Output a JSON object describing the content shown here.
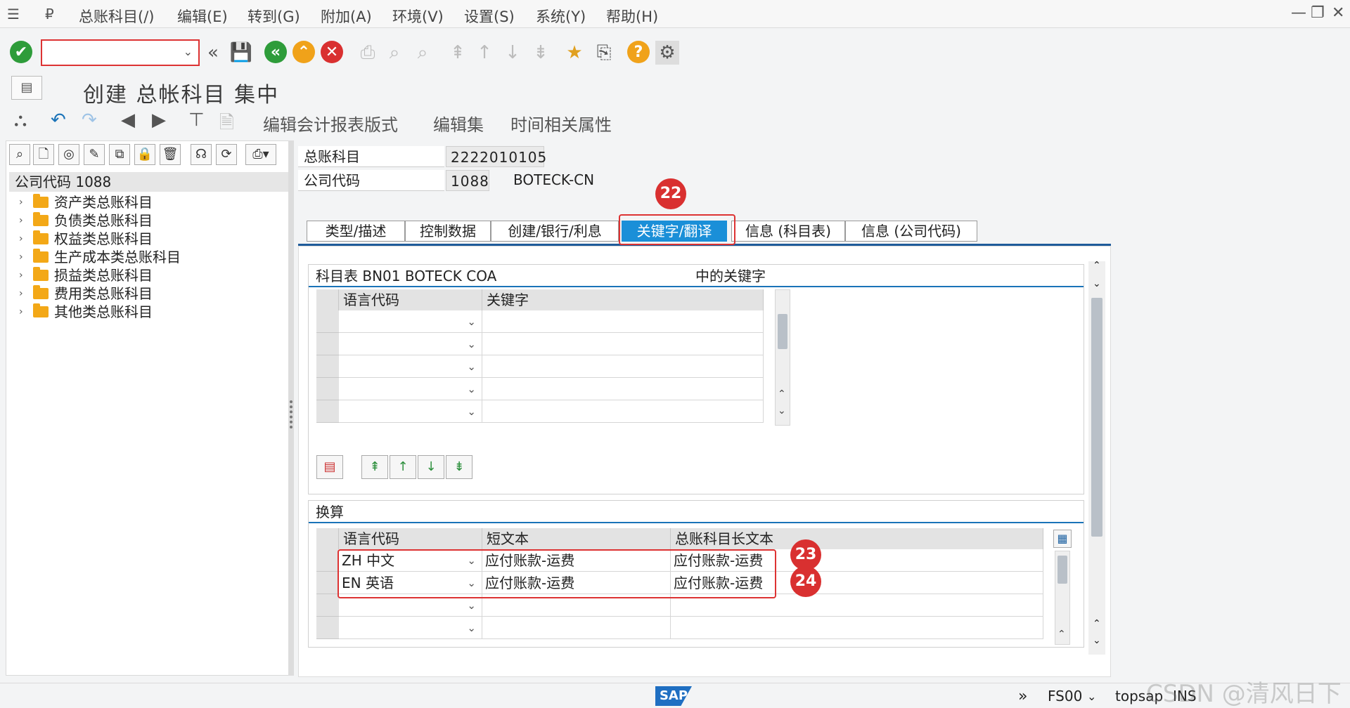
{
  "menubar": {
    "items": [
      "总账科目(/)",
      "编辑(E)",
      "转到(G)",
      "附加(A)",
      "环境(V)",
      "设置(S)",
      "系统(Y)",
      "帮助(H)"
    ]
  },
  "toolbar": {
    "command_value": ""
  },
  "title": "创建 总帐科目 集中",
  "apptoolbar": {
    "btn1": "编辑会计报表版式",
    "btn2": "编辑集",
    "btn3": "时间相关属性"
  },
  "tree": {
    "header": "公司代码 1088",
    "items": [
      "资产类总账科目",
      "负债类总账科目",
      "权益类总账科目",
      "生产成本类总账科目",
      "损益类总账科目",
      "费用类总账科目",
      "其他类总账科目"
    ]
  },
  "fields": {
    "gl_account_label": "总账科目",
    "gl_account_value": "2222010105",
    "company_label": "公司代码",
    "company_value": "1088",
    "company_name": "BOTECK-CN"
  },
  "tabs": [
    "类型/描述",
    "控制数据",
    "创建/银行/利息",
    "关键字/翻译",
    "信息 (科目表)",
    "信息 (公司代码)"
  ],
  "keywords": {
    "header_left": "科目表 BN01 BOTECK COA",
    "header_right": "中的关键字",
    "col1": "语言代码",
    "col2": "关键字"
  },
  "translation": {
    "header": "换算",
    "col1": "语言代码",
    "col2": "短文本",
    "col3": "总账科目长文本",
    "rows": [
      {
        "lang": "ZH 中文",
        "short": "应付账款-运费",
        "long": "应付账款-运费"
      },
      {
        "lang": "EN 英语",
        "short": "应付账款-运费",
        "long": "应付账款-运费"
      }
    ]
  },
  "badges": [
    "22",
    "23",
    "24"
  ],
  "status": {
    "tcode": "FS00",
    "server": "topsap",
    "mode": "INS",
    "sap": "SAP"
  },
  "watermark": "CSDN @清风日下",
  "colors": {
    "accent": "#1a8fd8",
    "annotation": "#d93030",
    "folder": "#f3a817"
  }
}
